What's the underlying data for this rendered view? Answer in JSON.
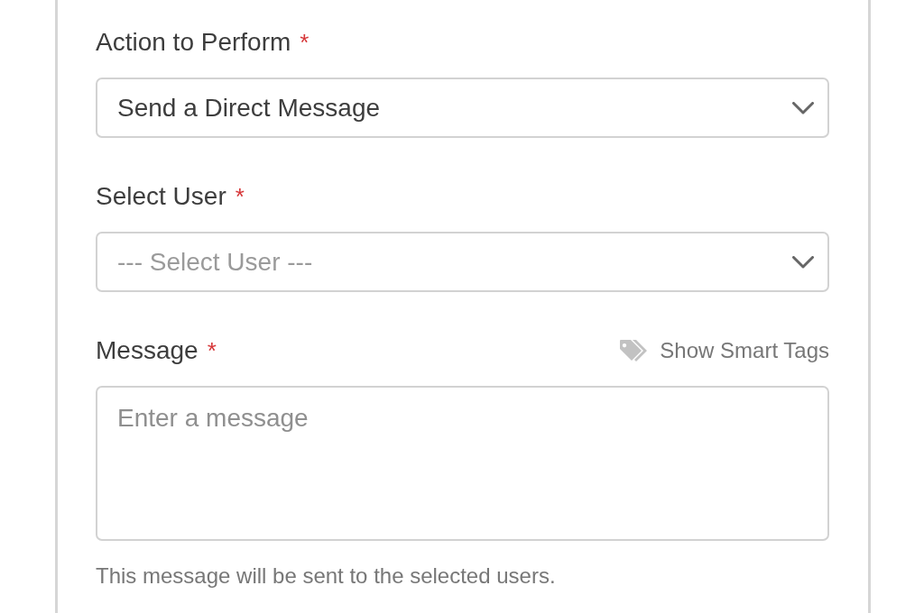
{
  "fields": [
    {
      "kind": "select",
      "label": "Action to Perform",
      "required_mark": "*",
      "value": "Send a Direct Message"
    },
    {
      "kind": "select",
      "label": "Select User",
      "required_mark": "*",
      "placeholder": "--- Select User ---"
    },
    {
      "kind": "textarea",
      "label": "Message",
      "required_mark": "*",
      "link": {
        "label": "Show Smart Tags"
      },
      "placeholder": "Enter a message",
      "help": "This message will be sent to the selected users."
    }
  ]
}
